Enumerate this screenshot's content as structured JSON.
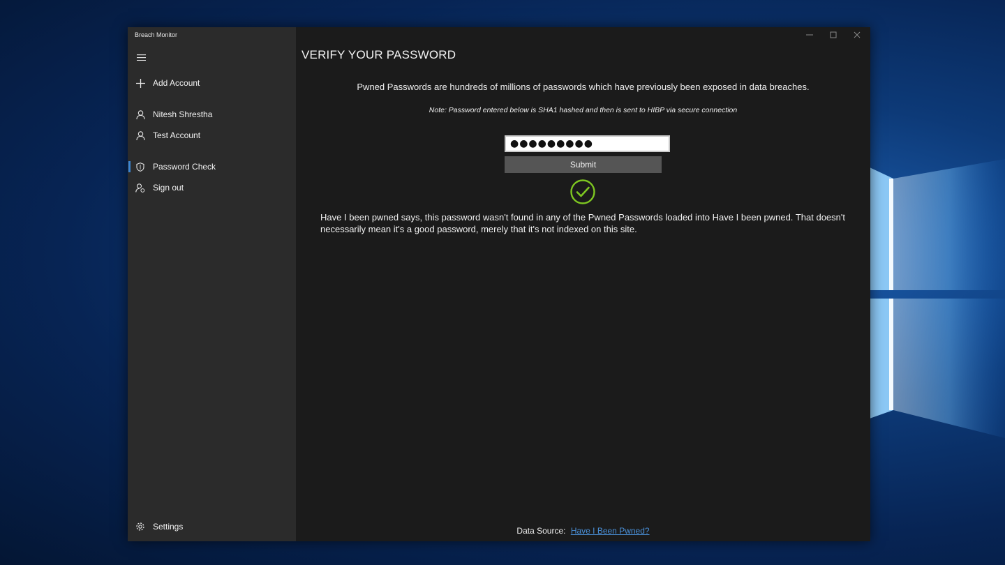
{
  "window": {
    "title": "Breach Monitor"
  },
  "sidebar": {
    "items": [
      {
        "label": "Add Account",
        "icon": "plus-icon"
      },
      {
        "label": "Nitesh Shrestha",
        "icon": "person-icon"
      },
      {
        "label": "Test Account",
        "icon": "person-icon"
      },
      {
        "label": "Password Check",
        "icon": "shield-icon",
        "selected": true
      },
      {
        "label": "Sign out",
        "icon": "sign-out-icon"
      }
    ],
    "settings_label": "Settings"
  },
  "main": {
    "title": "VERIFY YOUR PASSWORD",
    "intro": "Pwned Passwords are hundreds of millions of passwords which have previously been exposed in data breaches.",
    "note": "Note: Password entered below is SHA1 hashed and then is sent to HIBP via secure connection",
    "password_value": "●●●●●●●●●",
    "submit_label": "Submit",
    "result_text": "Have I been pwned says, this password wasn't found in any of the Pwned Passwords loaded into Have I been pwned. That doesn't necessarily mean it's a good password, merely that it's not indexed on this site.",
    "footer_label": "Data Source:",
    "footer_link": "Have I Been Pwned?"
  },
  "colors": {
    "accent": "#3b86d4",
    "success": "#7ec721",
    "link": "#4a90d9"
  }
}
